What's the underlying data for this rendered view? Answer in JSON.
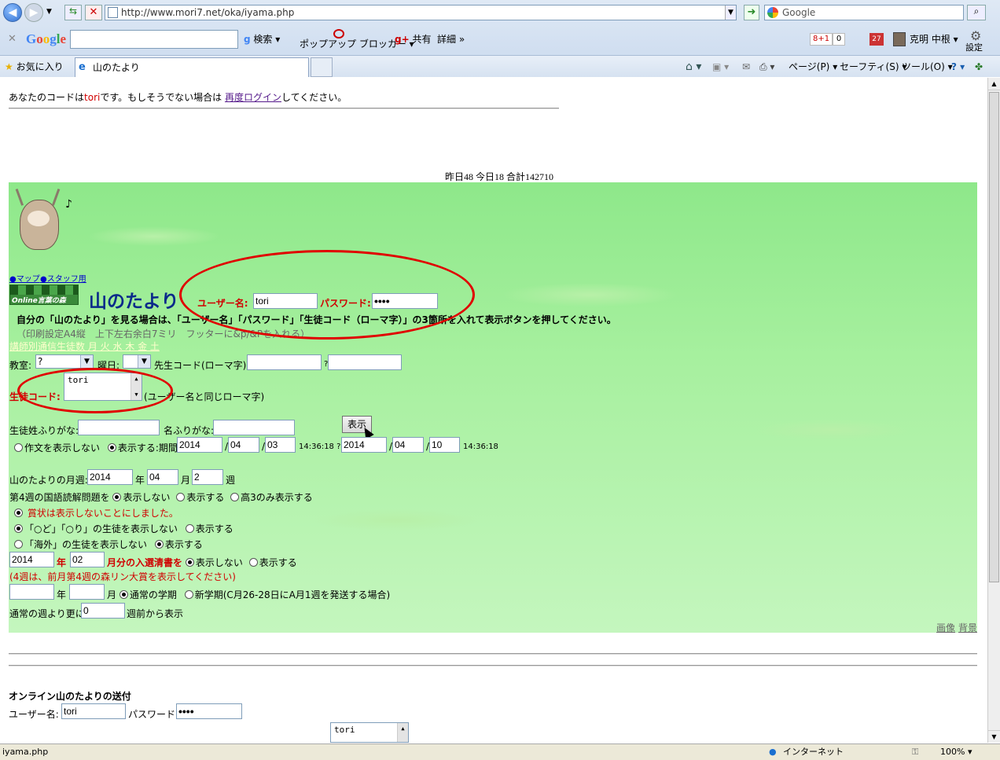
{
  "browser": {
    "url": "http://www.mori7.net/oka/iyama.php",
    "search_placeholder": "Google",
    "google_search_label": "検索",
    "popup_blocker_label": "ポップアップ ブロッカー",
    "share_label": "共有",
    "details_label": "詳細",
    "badge_plus": "8+1",
    "badge_zero": "0",
    "notif_count": "27",
    "user_name": "克明 中根",
    "settings_label": "設定",
    "favorites_label": "お気に入り",
    "tab_title": "山のたより",
    "cmd_page": "ページ(P)",
    "cmd_safety": "セーフティ(S)",
    "cmd_tools": "ツール(O)",
    "status_left": "iyama.php",
    "status_zone": "インターネット",
    "status_zoom": "100%"
  },
  "page": {
    "login_prefix": "あなたのコードは",
    "login_code": "tori",
    "login_mid": "です。もしそうでない場合は ",
    "relogin_link": "再度ログイン",
    "login_suffix": "してください。",
    "counter": "昨日48 今日18 合計142710",
    "map_link": "●マップ",
    "staff_link": "●スタッフ用",
    "logo_text": "Online言葉の森",
    "title": "山のたより",
    "username_label": "ユーザー名:",
    "username_value": "tori",
    "password_label": "パスワード:",
    "password_value": "••••",
    "instruction": "自分の「山のたより」を見る場合は、「ユーザー名」「パスワード」「生徒コード（ローマ字）」の3箇所を入れて表示ボタンを押してください。",
    "print_note": "（印刷設定A4縦　上下左右余白7ミリ　フッターに&p/&Pを入れる）",
    "weekday_links": "講師別通信生徒数 月 火 水 木 金 土",
    "classroom_label": "教室:",
    "classroom_value": "?",
    "weekday_label": "曜日:",
    "teacher_code_label": "先生コード(ローマ字):",
    "q_mark": "?",
    "student_code_label": "生徒コード:",
    "student_code_value": "tori",
    "student_code_note": "(ユーザー名と同じローマ字)",
    "show_button": "表示",
    "surname_kana_label": "生徒姓ふりがな:",
    "name_kana_label": "名ふりがな:",
    "essay_hide": "作文を表示しない",
    "essay_show": "表示する:期間",
    "date_from_y": "2014",
    "date_from_m": "04",
    "date_from_d": "03",
    "time_from": "14:36:18 ?",
    "date_to_y": "2014",
    "date_to_m": "04",
    "date_to_d": "10",
    "time_to": "14:36:18",
    "slash": "/",
    "monthly_label": "山のたよりの月週:",
    "monthly_y": "2014",
    "year": "年",
    "monthly_m": "04",
    "month": "月",
    "monthly_w": "2",
    "week": "週",
    "q4_label": "第4週の国語読解問題を",
    "opt_hide": "表示しない",
    "opt_show": "表示する",
    "opt_high3": "高3のみ表示する",
    "award_note": "賞状は表示しないことにしました。",
    "odo_label": "「○ど」「○り」の生徒を表示しない",
    "overseas_label": "「海外」の生徒を表示しない",
    "entry_y": "2014",
    "entry_m": "02",
    "entry_label": "月分の入選清書を",
    "week4_note": "(4週は、前月第4週の森リン大賞を表示してください)",
    "normal_term": "通常の学期",
    "new_term": "新学期(C月26-28日にA月1週を発送する場合)",
    "week_before_label": "通常の週より更に",
    "week_before_value": "0",
    "week_before_suffix": "週前から表示",
    "img_link": "画像",
    "bg_link": "背景",
    "send_title": "オンライン山のたよりの送付",
    "send_user_label": "ユーザー名:",
    "send_user_value": "tori",
    "send_pass_label": "パスワード:",
    "send_pass_value": "••••",
    "send_code_value": "tori"
  }
}
